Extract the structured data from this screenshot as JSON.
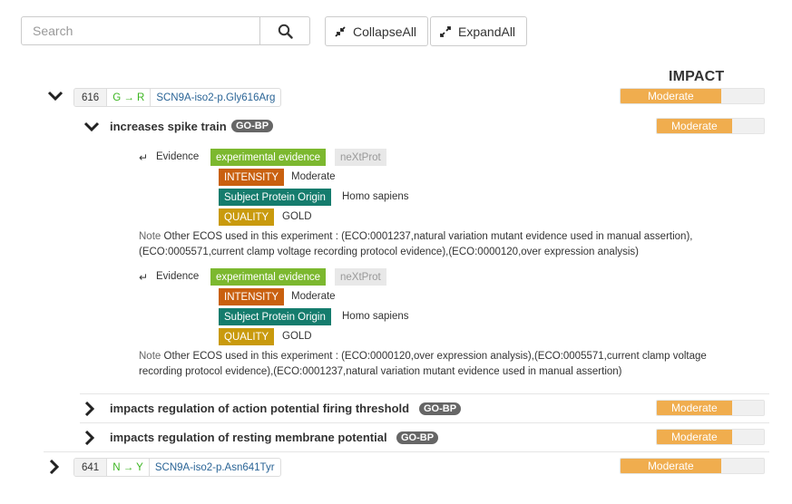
{
  "toolbar": {
    "search_placeholder": "Search",
    "collapse_label": "CollapseAll",
    "expand_label": "ExpandAll"
  },
  "impact_header": "IMPACT",
  "variants": [
    {
      "position": "616",
      "change": "G → R",
      "name": "SCN9A-iso2-p.Gly616Arg",
      "impact": "Moderate",
      "expanded": true,
      "terms": [
        {
          "label": "increases spike train",
          "tag": "GO-BP",
          "impact": "Moderate",
          "expanded": true,
          "evidences": [
            {
              "evidence_label": "Evidence",
              "type": "experimental evidence",
              "source": "neXtProt",
              "intensity_key": "INTENSITY",
              "intensity_value": "Moderate",
              "origin_key": "Subject Protein Origin",
              "origin_value": "Homo sapiens",
              "quality_key": "QUALITY",
              "quality_value": "GOLD",
              "note_key": "Note",
              "note_line1": "Other ECOS used in this experiment : (ECO:0001237,natural variation mutant evidence used in manual assertion),",
              "note_line2": "(ECO:0005571,current clamp voltage recording protocol evidence),(ECO:0000120,over expression analysis)"
            },
            {
              "evidence_label": "Evidence",
              "type": "experimental evidence",
              "source": "neXtProt",
              "intensity_key": "INTENSITY",
              "intensity_value": "Moderate",
              "origin_key": "Subject Protein Origin",
              "origin_value": "Homo sapiens",
              "quality_key": "QUALITY",
              "quality_value": "GOLD",
              "note_key": "Note",
              "note_line1": "Other ECOS used in this experiment : (ECO:0000120,over expression analysis),(ECO:0005571,current clamp voltage",
              "note_line2": "recording protocol evidence),(ECO:0001237,natural variation mutant evidence used in manual assertion)"
            }
          ]
        },
        {
          "label": "impacts regulation of action potential firing threshold",
          "tag": "GO-BP",
          "impact": "Moderate",
          "expanded": false
        },
        {
          "label": "impacts regulation of resting membrane potential",
          "tag": "GO-BP",
          "impact": "Moderate",
          "expanded": false
        }
      ]
    },
    {
      "position": "641",
      "change": "N → Y",
      "name": "SCN9A-iso2-p.Asn641Tyr",
      "impact": "Moderate",
      "expanded": false
    }
  ],
  "impact_fill_fraction": 0.7
}
